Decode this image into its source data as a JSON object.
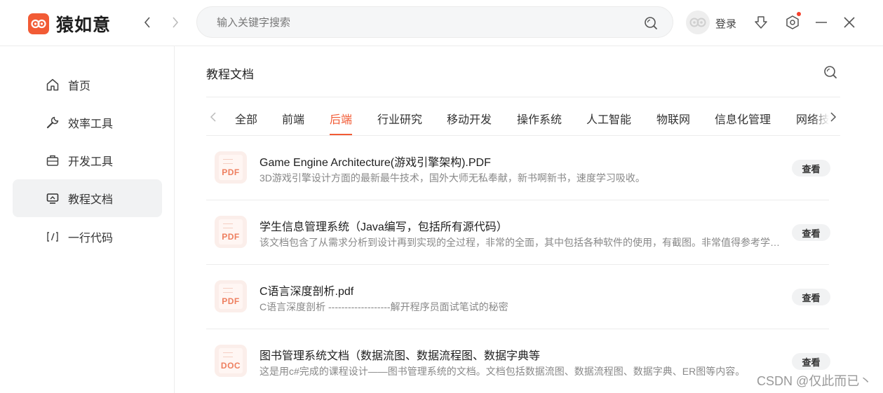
{
  "header": {
    "brand_name": "猿如意",
    "search_placeholder": "输入关键字搜索",
    "login_label": "登录"
  },
  "sidebar": {
    "items": [
      {
        "label": "首页",
        "icon": "home-icon",
        "active": false
      },
      {
        "label": "效率工具",
        "icon": "wrench-icon",
        "active": false
      },
      {
        "label": "开发工具",
        "icon": "briefcase-icon",
        "active": false
      },
      {
        "label": "教程文档",
        "icon": "monitor-icon",
        "active": true
      },
      {
        "label": "一行代码",
        "icon": "code-icon",
        "active": false
      }
    ]
  },
  "main": {
    "section_title": "教程文档",
    "tabs": [
      {
        "label": "全部"
      },
      {
        "label": "前端"
      },
      {
        "label": "后端",
        "active": true
      },
      {
        "label": "行业研究"
      },
      {
        "label": "移动开发"
      },
      {
        "label": "操作系统"
      },
      {
        "label": "人工智能"
      },
      {
        "label": "物联网"
      },
      {
        "label": "信息化管理"
      },
      {
        "label": "网络技术"
      }
    ],
    "docs": [
      {
        "type": "PDF",
        "title": "Game Engine Architecture(游戏引擎架构).PDF",
        "desc": "3D游戏引擎设计方面的最新最牛技术，国外大师无私奉献，新书啊新书，速度学习吸收。",
        "action": "查看"
      },
      {
        "type": "PDF",
        "title": "学生信息管理系统（Java编写，包括所有源代码）",
        "desc": "该文档包含了从需求分析到设计再到实现的全过程，非常的全面，其中包括各种软件的使用，有截图。非常值得参考学习。",
        "action": "查看"
      },
      {
        "type": "PDF",
        "title": "C语言深度剖析.pdf",
        "desc": "C语言深度剖析 -------------------解开程序员面试笔试的秘密",
        "action": "查看"
      },
      {
        "type": "DOC",
        "title": "图书管理系统文档（数据流图、数据流程图、数据字典等",
        "desc": "这是用c#完成的课程设计——图书管理系统的文档。文档包括数据流图、数据流程图、数据字典、ER图等内容。",
        "action": "查看"
      }
    ]
  },
  "watermark": "CSDN @仅此而已丶",
  "colors": {
    "accent": "#f25b35",
    "active_bg": "#f1f2f3",
    "desc_text": "#888888"
  }
}
